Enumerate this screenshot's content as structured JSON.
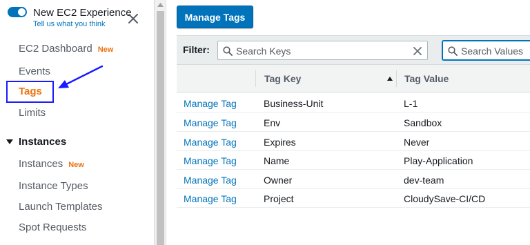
{
  "sidebar": {
    "experience_title": "New EC2 Experience",
    "experience_link": "Tell us what you think",
    "nav": [
      {
        "label": "EC2 Dashboard",
        "badge": "New"
      },
      {
        "label": "Events"
      },
      {
        "label": "Tags",
        "active": true
      },
      {
        "label": "Limits"
      }
    ],
    "section": {
      "label": "Instances",
      "items": [
        {
          "label": "Instances",
          "badge": "New"
        },
        {
          "label": "Instance Types"
        },
        {
          "label": "Launch Templates"
        },
        {
          "label": "Spot Requests"
        }
      ]
    }
  },
  "main": {
    "manage_tags_button": "Manage Tags",
    "filter": {
      "label": "Filter:",
      "keys_placeholder": "Search Keys",
      "values_placeholder": "Search Values"
    },
    "table": {
      "columns": [
        "Tag Key",
        "Tag Value"
      ],
      "rows": [
        {
          "action": "Manage Tag",
          "key": "Business-Unit",
          "value": "L-1"
        },
        {
          "action": "Manage Tag",
          "key": "Env",
          "value": "Sandbox"
        },
        {
          "action": "Manage Tag",
          "key": "Expires",
          "value": "Never"
        },
        {
          "action": "Manage Tag",
          "key": "Name",
          "value": "Play-Application"
        },
        {
          "action": "Manage Tag",
          "key": "Owner",
          "value": "dev-team"
        },
        {
          "action": "Manage Tag",
          "key": "Project",
          "value": "CloudySave-CI/CD"
        }
      ]
    }
  },
  "colors": {
    "accent_blue": "#0073bb",
    "active_orange": "#ec7211",
    "annotation_blue": "#1a1aff"
  },
  "icons": [
    "toggle-switch",
    "close-icon",
    "arrow-annotation",
    "caret-down-icon",
    "search-icon",
    "clear-icon",
    "sort-ascending-icon",
    "scroll-up-icon"
  ]
}
